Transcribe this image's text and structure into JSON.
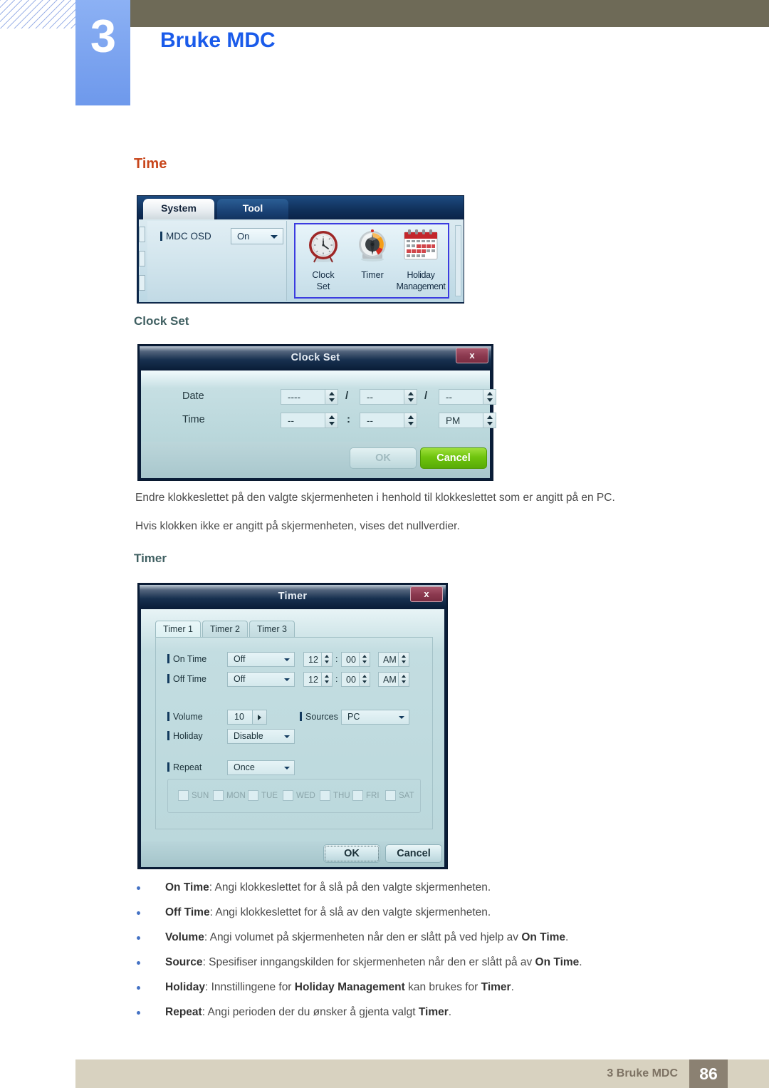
{
  "header": {
    "chapter_number": "3",
    "title": "Bruke MDC"
  },
  "sections": {
    "time_heading": "Time",
    "clock_set_heading": "Clock Set",
    "timer_heading": "Timer"
  },
  "paragraphs": {
    "p1": "Endre klokkeslettet på den valgte skjermenheten i henhold til klokkeslettet som er angitt på en PC.",
    "p2": "Hvis klokken ikke er angitt på skjermenheten, vises det nullverdier."
  },
  "system_panel": {
    "tabs": [
      {
        "label": "System",
        "selected": true
      },
      {
        "label": "Tool",
        "selected": false
      }
    ],
    "mdc_osd": {
      "label": "MDC OSD",
      "value": "On"
    },
    "icons": [
      {
        "name": "clock-set",
        "label_line1": "Clock",
        "label_line2": "Set"
      },
      {
        "name": "timer",
        "label_line1": "Timer",
        "label_line2": ""
      },
      {
        "name": "holiday-management",
        "label_line1": "Holiday",
        "label_line2": "Management"
      }
    ],
    "highlight_color": "#3b3be0"
  },
  "clock_set_dialog": {
    "title": "Clock Set",
    "close_label": "x",
    "date_label": "Date",
    "time_label": "Time",
    "date_year": "----",
    "date_month": "--",
    "date_day": "--",
    "date_sep1": "/",
    "date_sep2": "/",
    "time_hour": "--",
    "time_minute": "--",
    "time_ampm": "PM",
    "time_sep": ":",
    "ok_label": "OK",
    "cancel_label": "Cancel",
    "cancel_color": "#6fc40e"
  },
  "timer_dialog": {
    "title": "Timer",
    "close_label": "x",
    "tabs": [
      {
        "label": "Timer 1",
        "selected": true
      },
      {
        "label": "Timer 2",
        "selected": false
      },
      {
        "label": "Timer 3",
        "selected": false
      }
    ],
    "on_time": {
      "label": "On Time",
      "state": "Off",
      "hour": "12",
      "minute": "00",
      "ampm": "AM",
      "sep": ":"
    },
    "off_time": {
      "label": "Off Time",
      "state": "Off",
      "hour": "12",
      "minute": "00",
      "ampm": "AM",
      "sep": ":"
    },
    "volume": {
      "label": "Volume",
      "value": "10"
    },
    "sources": {
      "label": "Sources",
      "value": "PC"
    },
    "holiday": {
      "label": "Holiday",
      "value": "Disable"
    },
    "repeat": {
      "label": "Repeat",
      "value": "Once"
    },
    "days": [
      {
        "label": "SUN",
        "checked": false
      },
      {
        "label": "MON",
        "checked": false
      },
      {
        "label": "TUE",
        "checked": false
      },
      {
        "label": "WED",
        "checked": false
      },
      {
        "label": "THU",
        "checked": false
      },
      {
        "label": "FRI",
        "checked": false
      },
      {
        "label": "SAT",
        "checked": false
      }
    ],
    "ok_label": "OK",
    "cancel_label": "Cancel"
  },
  "bullets": [
    {
      "term": "On Time",
      "rest": ": Angi klokkeslettet for å slå på den valgte skjermenheten."
    },
    {
      "term": "Off Time",
      "rest": ": Angi klokkeslettet for å slå av den valgte skjermenheten."
    },
    {
      "term": "Volume",
      "rest": ": Angi volumet på skjermenheten når den er slått på ved hjelp av ",
      "term2": "On Time",
      "rest2": "."
    },
    {
      "term": "Source",
      "rest": ": Spesifiser inngangskilden for skjermenheten når den er slått på av ",
      "term2": "On Time",
      "rest2": "."
    },
    {
      "term": "Holiday",
      "rest": ": Innstillingene for ",
      "term2": "Holiday Management",
      "rest2": " kan brukes for ",
      "term3": "Timer",
      "rest3": "."
    },
    {
      "term": "Repeat",
      "rest": ": Angi perioden der du ønsker å gjenta valgt ",
      "term2": "Timer",
      "rest2": "."
    }
  ],
  "footer": {
    "text": "3 Bruke MDC",
    "page_number": "86"
  }
}
